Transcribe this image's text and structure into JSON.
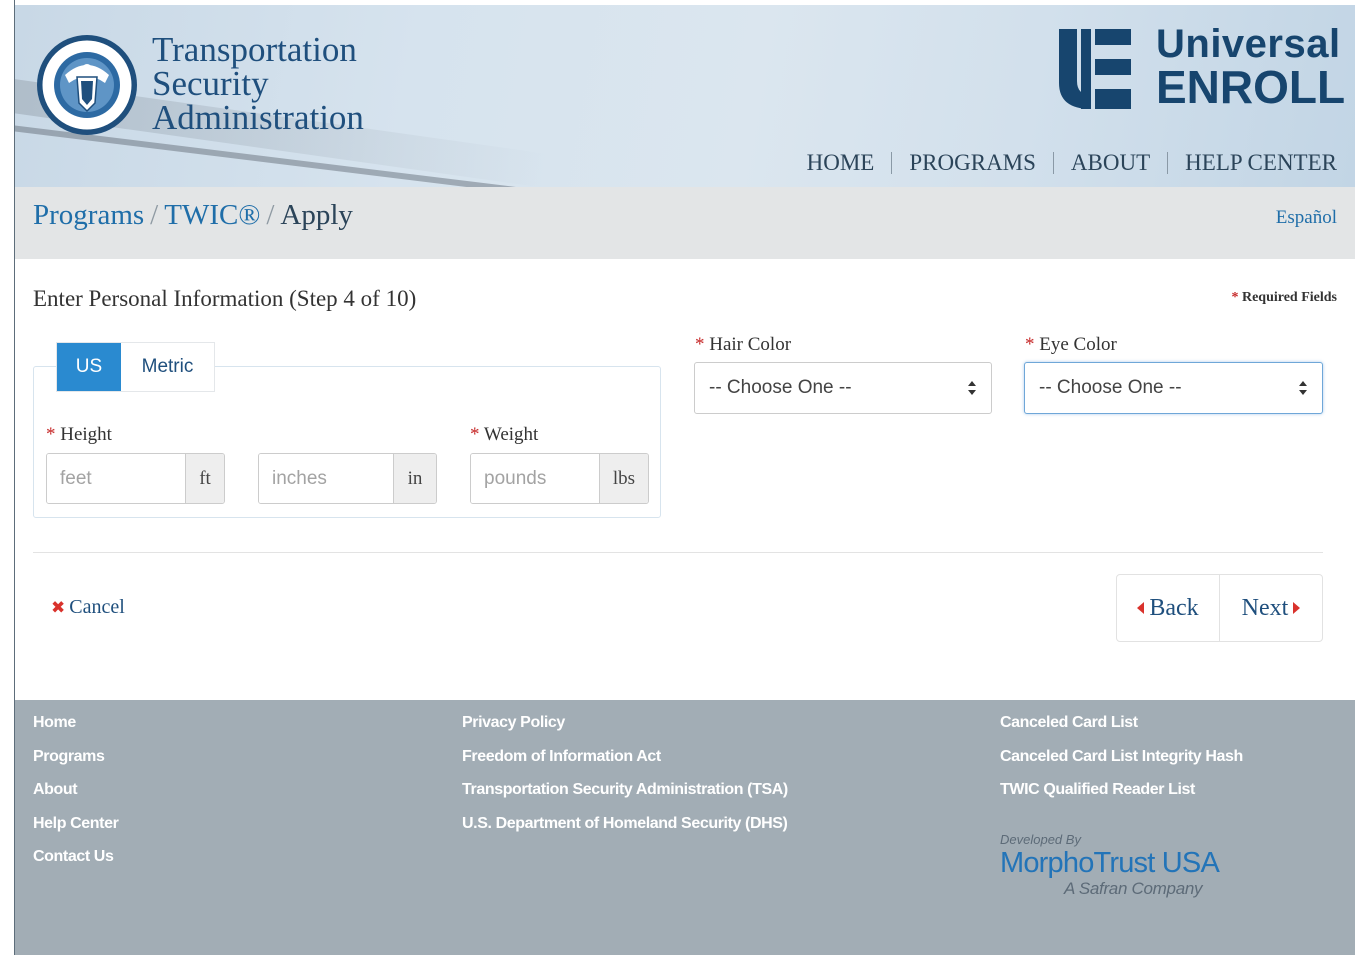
{
  "header": {
    "agency_lines": [
      "Transportation",
      "Security",
      "Administration"
    ],
    "brand_line1": "Universal",
    "brand_line2": "ENROLL",
    "nav": [
      "HOME",
      "PROGRAMS",
      "ABOUT",
      "HELP CENTER"
    ]
  },
  "breadcrumb": {
    "items": [
      "Programs",
      "TWIC®"
    ],
    "current": "Apply",
    "separator": "/",
    "language_link": "Español"
  },
  "form": {
    "step_title": "Enter Personal Information (Step 4 of 10)",
    "required_marker": "*",
    "required_note": "Required Fields",
    "units": {
      "us": "US",
      "metric": "Metric",
      "selected": "US"
    },
    "height_label": "Height",
    "weight_label": "Weight",
    "feet": {
      "placeholder": "feet",
      "value": "",
      "unit": "ft"
    },
    "inches": {
      "placeholder": "inches",
      "value": "",
      "unit": "in"
    },
    "pounds": {
      "placeholder": "pounds",
      "value": "",
      "unit": "lbs"
    },
    "hair_color_label": "Hair Color",
    "hair_color_value": "-- Choose One --",
    "eye_color_label": "Eye Color",
    "eye_color_value": "-- Choose One --",
    "cancel_label": "Cancel",
    "back_label": "Back",
    "next_label": "Next"
  },
  "footer": {
    "col1": [
      "Home",
      "Programs",
      "About",
      "Help Center",
      "Contact Us"
    ],
    "col2": [
      "Privacy Policy",
      "Freedom of Information Act",
      "Transportation Security Administration (TSA)",
      "U.S. Department of Homeland Security (DHS)"
    ],
    "col3": [
      "Canceled Card List",
      "Canceled Card List Integrity Hash",
      "TWIC Qualified Reader List"
    ],
    "developed_by": "Developed By",
    "developer": "MorphoTrust USA",
    "developer_sub": "A Safran Company"
  },
  "colors": {
    "primary_blue": "#1f4f7d",
    "link_blue": "#1f6ea9",
    "active_toggle": "#2a8ad0",
    "required_red": "#c62828",
    "footer_bg": "#a2adb5"
  },
  "icons": {
    "seal": "dhs-seal-icon",
    "brand": "ue-logo-icon",
    "cancel": "x-icon",
    "back": "caret-left-icon",
    "next": "caret-right-icon",
    "select": "up-down-arrows-icon"
  }
}
